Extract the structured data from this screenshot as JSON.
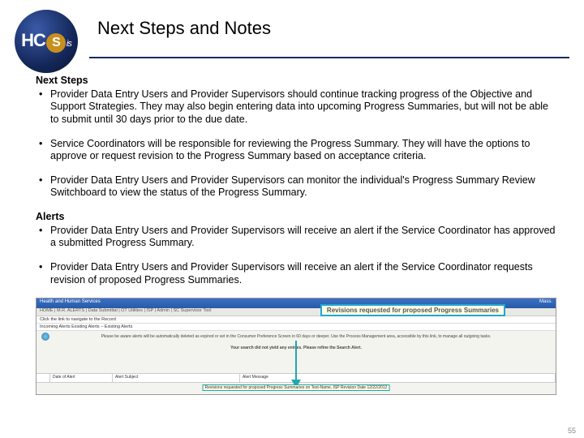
{
  "logo": {
    "h": "H",
    "c": "C",
    "s": "S",
    "is": "is"
  },
  "title": "Next Steps and Notes",
  "sections": {
    "nextSteps": {
      "heading": "Next Steps",
      "items": [
        "Provider Data Entry Users and Provider Supervisors should continue tracking progress of the Objective and Support Strategies. They may also begin entering data into upcoming Progress Summaries, but will not be able to submit until 30 days prior to the due date.",
        "Service Coordinators will be responsible for reviewing the Progress Summary. They will have the options to approve or request revision to the Progress Summary based on acceptance criteria.",
        "Provider Data Entry Users and Provider Supervisors can monitor the individual's Progress Summary Review Switchboard to view the status of the Progress Summary."
      ]
    },
    "alerts": {
      "heading": "Alerts",
      "items": [
        "Provider Data Entry Users and Provider Supervisors will receive an alert if the Service Coordinator has approved a submitted Progress Summary.",
        "Provider Data Entry Users and Provider Supervisors will receive an alert if the Service Coordinator requests revision of proposed Progress Summaries."
      ]
    }
  },
  "screenshot": {
    "titlebar_left": "Health and Human Services",
    "titlebar_right": "Mass.",
    "menubar": "HOME | M.R. ALERTS | Data Submittal | OT Utilities | ISP | Admin | SC Supervisor Tool",
    "row1": "Click the link to navigate to the Record",
    "row2": "Incoming Alerts      Existing Alerts – Existing Alerts",
    "callout": "Revisions requested for proposed Progress Summaries",
    "middle_line1": "Please be aware alerts will be automatically deleted as expired or set in the Consumer Preference Screen in 60 days or deeper. Use the Process Management area, accessible by this link, to manage all outgoing tasks.",
    "middle_line2": "Your search did not yield any entries. Please refine the Search Alert.",
    "arrow_target": "Revisions requested for proposed Progress Summaries",
    "trail": "on Test-Name, ISP Revision Date  12/22/2012",
    "table": {
      "c1": "Date of Alert",
      "c2": "Alert Subject",
      "c3": "Alert Message"
    }
  },
  "page_number": "55"
}
